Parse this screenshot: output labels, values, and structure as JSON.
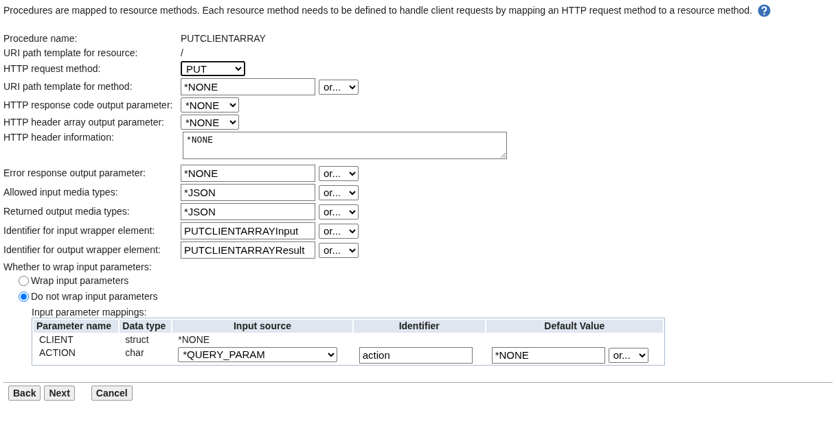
{
  "intro": "Procedures are mapped to resource methods. Each resource method needs to be defined to handle client requests by mapping an HTTP request method to a resource method.",
  "fields": [
    {
      "kind": "static",
      "label": "Procedure name:",
      "value": "PUTCLIENTARRAY"
    },
    {
      "kind": "static",
      "label": "URI path template for resource:",
      "value": "/"
    },
    {
      "kind": "select",
      "label": "HTTP request method:",
      "value": "PUT",
      "focused": true
    },
    {
      "kind": "input_or",
      "label": "URI path template for method:",
      "value": "*NONE",
      "or_label": "or..."
    },
    {
      "kind": "select",
      "label": "HTTP response code output parameter:",
      "value": "*NONE",
      "focused": false
    },
    {
      "kind": "select",
      "label": "HTTP header array output parameter:",
      "value": "*NONE",
      "focused": false
    },
    {
      "kind": "textarea",
      "label": "HTTP header information:",
      "value": "*NONE"
    },
    {
      "kind": "input_or",
      "label": "Error response output parameter:",
      "value": "*NONE",
      "or_label": "or..."
    },
    {
      "kind": "input_or",
      "label": "Allowed input media types:",
      "value": "*JSON",
      "or_label": "or..."
    },
    {
      "kind": "input_or",
      "label": "Returned output media types:",
      "value": "*JSON",
      "or_label": "or..."
    },
    {
      "kind": "input_or",
      "label": "Identifier for input wrapper element:",
      "value": "PUTCLIENTARRAYInput",
      "or_label": "or..."
    },
    {
      "kind": "input_or",
      "label": "Identifier for output wrapper element:",
      "value": "PUTCLIENTARRAYResult",
      "or_label": "or..."
    }
  ],
  "wrap": {
    "label": "Whether to wrap input parameters:",
    "options": [
      {
        "label": "Wrap input parameters",
        "selected": false
      },
      {
        "label": "Do not wrap input parameters",
        "selected": true
      }
    ]
  },
  "mappings": {
    "label": "Input parameter mappings:",
    "columns": [
      "Parameter name",
      "Data type",
      "Input source",
      "Identifier",
      "Default Value"
    ],
    "rows": [
      {
        "parameter": "CLIENT",
        "data_type": "struct",
        "source": {
          "kind": "text",
          "value": "*NONE"
        }
      },
      {
        "parameter": "ACTION",
        "data_type": "char",
        "source": {
          "kind": "select",
          "value": "*QUERY_PARAM"
        },
        "identifier": "action",
        "default": "*NONE",
        "default_or": "or..."
      }
    ]
  },
  "nav_buttons": [
    "Back",
    "Next"
  ],
  "cancel_button": "Cancel"
}
